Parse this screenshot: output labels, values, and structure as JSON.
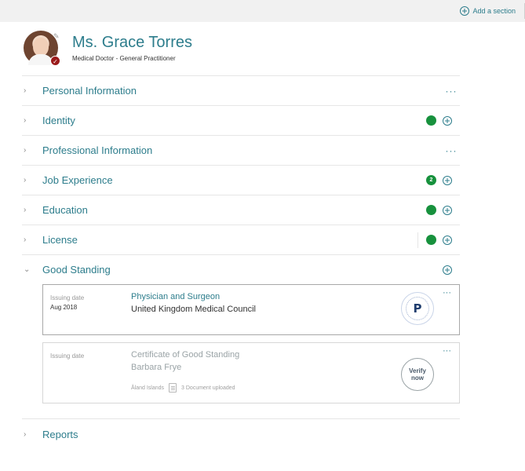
{
  "topbar": {
    "add_section_label": "Add a section",
    "add_icon": "plus-circle-icon"
  },
  "profile": {
    "name": "Ms. Grace Torres",
    "title": "Medical Doctor - General Practitioner",
    "badge_icon": "check-icon",
    "edit_icon": "pencil-icon"
  },
  "sections": [
    {
      "label": "Personal Information",
      "status": "none",
      "actions": "menu"
    },
    {
      "label": "Identity",
      "status": "complete",
      "actions": "add"
    },
    {
      "label": "Professional Information",
      "status": "none",
      "actions": "menu"
    },
    {
      "label": "Job Experience",
      "status": "count",
      "count": "2",
      "actions": "add"
    },
    {
      "label": "Education",
      "status": "complete",
      "actions": "add"
    },
    {
      "label": "License",
      "status": "complete",
      "actions": "add"
    }
  ],
  "good_standing": {
    "label": "Good Standing",
    "expanded": true,
    "certificates": [
      {
        "issuing_label": "Issuing date",
        "issuing_date": "Aug 2018",
        "title": "Physician and Surgeon",
        "issuer": "United Kingdom Medical Council",
        "badge": "verified-seal"
      },
      {
        "issuing_label": "Issuing date",
        "issuing_date": "",
        "title": "Certificate of Good Standing",
        "issuer": "Barbara Frye",
        "location": "Åland Islands",
        "documents": "3 Document uploaded",
        "verify_label_line1": "Verify",
        "verify_label_line2": "now"
      }
    ]
  },
  "reports": {
    "label": "Reports"
  },
  "colors": {
    "accent": "#2d7d8c",
    "status_green": "#17913d",
    "badge_red": "#9b1b1b"
  }
}
